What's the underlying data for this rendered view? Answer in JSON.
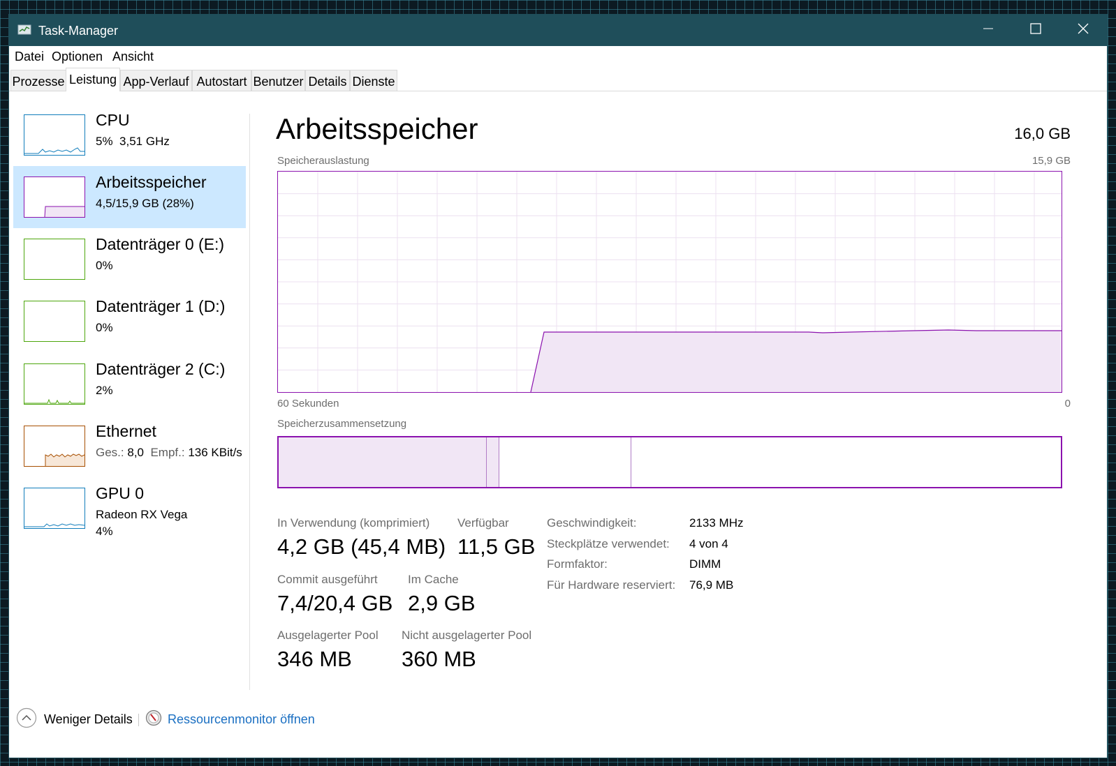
{
  "window": {
    "title": "Task-Manager"
  },
  "menu": [
    "Datei",
    "Optionen",
    "Ansicht"
  ],
  "tabs": [
    "Prozesse",
    "Leistung",
    "App-Verlauf",
    "Autostart",
    "Benutzer",
    "Details",
    "Dienste"
  ],
  "active_tab": "Leistung",
  "sidebar": {
    "cpu": {
      "name": "CPU",
      "usage": "5%",
      "speed": "3,51 GHz",
      "color": "#117dbb"
    },
    "memory": {
      "name": "Arbeitsspeicher",
      "detail": "4,5/15,9 GB (28%)",
      "color": "#8b12ae"
    },
    "disk0": {
      "name": "Datenträger 0 (E:)",
      "detail": "0%",
      "color": "#4da60c"
    },
    "disk1": {
      "name": "Datenträger 1 (D:)",
      "detail": "0%",
      "color": "#4da60c"
    },
    "disk2": {
      "name": "Datenträger 2 (C:)",
      "detail": "2%",
      "color": "#4da60c"
    },
    "ethernet": {
      "name": "Ethernet",
      "send_label": "Ges.:",
      "send_value": "8,0",
      "recv_label": "Empf.:",
      "recv_value": "136 KBit/s",
      "color": "#a74f01"
    },
    "gpu": {
      "name": "GPU 0",
      "model": "Radeon RX Vega",
      "detail": "4%",
      "color": "#117dbb"
    }
  },
  "main": {
    "title": "Arbeitsspeicher",
    "total": "16,0 GB",
    "usage_label": "Speicherauslastung",
    "usage_max": "15,9 GB",
    "time_left": "60 Sekunden",
    "time_right": "0",
    "composition_label": "Speicherzusammensetzung"
  },
  "stats": {
    "in_use_label": "In Verwendung (komprimiert)",
    "in_use_value": "4,2 GB (45,4 MB)",
    "available_label": "Verfügbar",
    "available_value": "11,5 GB",
    "commit_label": "Commit ausgeführt",
    "commit_value": "7,4/20,4 GB",
    "cache_label": "Im Cache",
    "cache_value": "2,9 GB",
    "paged_label": "Ausgelagerter Pool",
    "paged_value": "346 MB",
    "nonpaged_label": "Nicht ausgelagerter Pool",
    "nonpaged_value": "360 MB"
  },
  "specs": {
    "speed_label": "Geschwindigkeit:",
    "speed_value": "2133 MHz",
    "slots_label": "Steckplätze verwendet:",
    "slots_value": "4 von 4",
    "form_label": "Formfaktor:",
    "form_value": "DIMM",
    "reserved_label": "Für Hardware reserviert:",
    "reserved_value": "76,9 MB"
  },
  "footer": {
    "fewer_details": "Weniger Details",
    "resource_monitor": "Ressourcenmonitor öffnen"
  },
  "icons": {
    "app": "task-manager-icon",
    "minimize": "minimize-icon",
    "maximize": "maximize-icon",
    "close": "close-icon",
    "fewer": "chevron-up-circle-icon",
    "resmon": "resource-monitor-icon"
  },
  "colors": {
    "titlebar": "#1f4e5a",
    "memory_accent": "#8b12ae",
    "selected_bg": "#cce8ff",
    "link": "#1a6fc2"
  }
}
